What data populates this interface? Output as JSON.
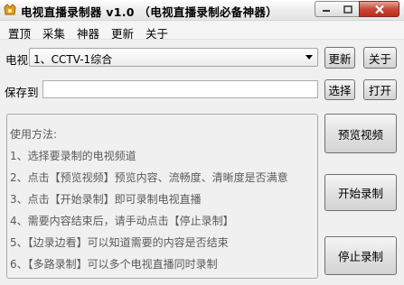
{
  "window": {
    "title": "电视直播录制器 v1.0 （电视直播录制必备神器）",
    "minimize_icon": "minimize-icon",
    "maximize_icon": "maximize-icon",
    "close_icon": "close-icon"
  },
  "menu": [
    "置顶",
    "采集",
    "神器",
    "更新",
    "关于"
  ],
  "channel": {
    "label": "电视",
    "selected": "1、CCTV-1综合",
    "update_button": "更新",
    "about_button": "关于"
  },
  "save": {
    "label": "保存到",
    "path_value": "",
    "browse_button": "选择",
    "open_button": "打开"
  },
  "instructions": {
    "heading": "使用方法:",
    "steps": [
      "1、选择要录制的电视频道",
      "2、点击【预览视频】预览内容、流畅度、清晰度是否满意",
      "3、点击【开始录制】即可录制电视直播",
      "4、需要内容结束后，请手动点击【停止录制】",
      "5、【边录边看】可以知道需要的内容是否结束",
      "6、【多路录制】可以多个电视直播同时录制"
    ]
  },
  "actions": {
    "preview_button": "预览视频",
    "start_button": "开始录制",
    "stop_button": "停止录制"
  },
  "colors": {
    "close_button": "#c7493a",
    "window_bg": "#f0f0f0"
  }
}
